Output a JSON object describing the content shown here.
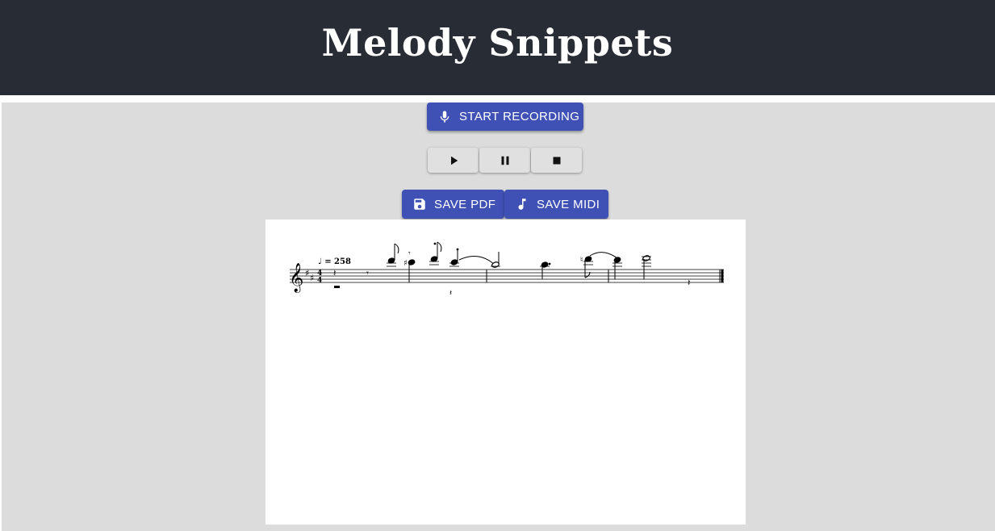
{
  "header": {
    "title": "Melody Snippets"
  },
  "controls": {
    "record_label": "START RECORDING",
    "record_icon": "microphone-icon",
    "play_icon": "play-icon",
    "pause_icon": "pause-icon",
    "stop_icon": "stop-icon",
    "save_pdf_label": "SAVE PDF",
    "save_pdf_icon": "floppy-disk-icon",
    "save_midi_label": "SAVE MIDI",
    "save_midi_icon": "music-note-icon"
  },
  "score": {
    "clef": "treble",
    "key_signature": "D major",
    "time_signature": "4/4",
    "tempo_text": "♩ = 258"
  },
  "colors": {
    "header_bg": "#282c34",
    "primary": "#3f51b5",
    "panel_bg": "#dcdcdc",
    "button_bg": "#e0e0e0"
  }
}
